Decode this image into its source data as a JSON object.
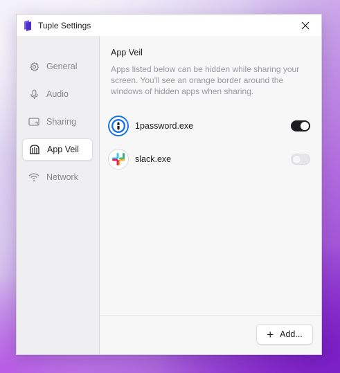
{
  "window": {
    "title": "Tuple Settings",
    "app_icon": "tuple-logo-icon",
    "close_icon": "close-icon"
  },
  "sidebar": {
    "items": [
      {
        "label": "General",
        "icon": "gear-icon",
        "active": false
      },
      {
        "label": "Audio",
        "icon": "microphone-icon",
        "active": false
      },
      {
        "label": "Sharing",
        "icon": "screen-share-icon",
        "active": false
      },
      {
        "label": "App Veil",
        "icon": "veil-icon",
        "active": true
      },
      {
        "label": "Network",
        "icon": "wifi-icon",
        "active": false
      }
    ]
  },
  "main": {
    "title": "App Veil",
    "description": "Apps listed below can be hidden while sharing your screen. You'll see an orange border around the windows of hidden apps when sharing.",
    "apps": [
      {
        "name": "1password.exe",
        "icon": "1password-icon",
        "enabled": true
      },
      {
        "name": "slack.exe",
        "icon": "slack-icon",
        "enabled": false
      }
    ],
    "add_button": {
      "label": "Add...",
      "icon": "plus-icon"
    }
  },
  "colors": {
    "accent": "#1d1d1f",
    "tuple_purple": "#5b3fd6",
    "onepassword_blue": "#1a72e8"
  }
}
